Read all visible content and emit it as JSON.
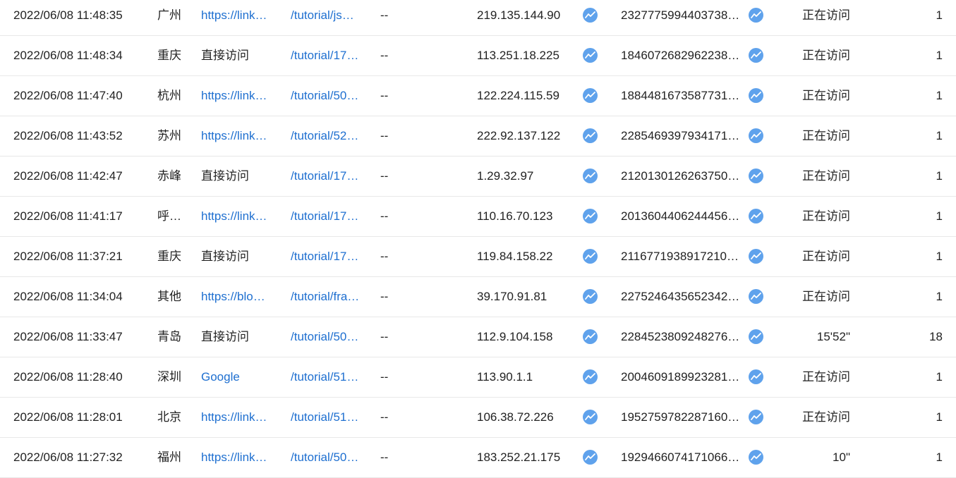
{
  "icons": {
    "trend": "trend-chart-icon",
    "trend_color": "#5fa2ec",
    "link_color": "#1e6fd0"
  },
  "rows": [
    {
      "time": "2022/06/08 11:48:35",
      "region": "广州",
      "source": "https://link…",
      "source_is_link": true,
      "page": "/tutorial/js…",
      "keyword": "--",
      "ip": "219.135.144.90",
      "visitor_id": "2327775994403738…",
      "duration": "正在访问",
      "pageviews": "1"
    },
    {
      "time": "2022/06/08 11:48:34",
      "region": "重庆",
      "source": "直接访问",
      "source_is_link": false,
      "page": "/tutorial/17…",
      "keyword": "--",
      "ip": "113.251.18.225",
      "visitor_id": "1846072682962238…",
      "duration": "正在访问",
      "pageviews": "1"
    },
    {
      "time": "2022/06/08 11:47:40",
      "region": "杭州",
      "source": "https://link…",
      "source_is_link": true,
      "page": "/tutorial/50…",
      "keyword": "--",
      "ip": "122.224.115.59",
      "visitor_id": "1884481673587731…",
      "duration": "正在访问",
      "pageviews": "1"
    },
    {
      "time": "2022/06/08 11:43:52",
      "region": "苏州",
      "source": "https://link…",
      "source_is_link": true,
      "page": "/tutorial/52…",
      "keyword": "--",
      "ip": "222.92.137.122",
      "visitor_id": "2285469397934171…",
      "duration": "正在访问",
      "pageviews": "1"
    },
    {
      "time": "2022/06/08 11:42:47",
      "region": "赤峰",
      "source": "直接访问",
      "source_is_link": false,
      "page": "/tutorial/17…",
      "keyword": "--",
      "ip": "1.29.32.97",
      "visitor_id": "2120130126263750…",
      "duration": "正在访问",
      "pageviews": "1"
    },
    {
      "time": "2022/06/08 11:41:17",
      "region": "呼…",
      "source": "https://link…",
      "source_is_link": true,
      "page": "/tutorial/17…",
      "keyword": "--",
      "ip": "110.16.70.123",
      "visitor_id": "2013604406244456…",
      "duration": "正在访问",
      "pageviews": "1"
    },
    {
      "time": "2022/06/08 11:37:21",
      "region": "重庆",
      "source": "直接访问",
      "source_is_link": false,
      "page": "/tutorial/17…",
      "keyword": "--",
      "ip": "119.84.158.22",
      "visitor_id": "2116771938917210…",
      "duration": "正在访问",
      "pageviews": "1"
    },
    {
      "time": "2022/06/08 11:34:04",
      "region": "其他",
      "source": "https://blo…",
      "source_is_link": true,
      "page": "/tutorial/fra…",
      "keyword": "--",
      "ip": "39.170.91.81",
      "visitor_id": "2275246435652342…",
      "duration": "正在访问",
      "pageviews": "1"
    },
    {
      "time": "2022/06/08 11:33:47",
      "region": "青岛",
      "source": "直接访问",
      "source_is_link": false,
      "page": "/tutorial/50…",
      "keyword": "--",
      "ip": "112.9.104.158",
      "visitor_id": "2284523809248276…",
      "duration": "15'52\"",
      "pageviews": "18"
    },
    {
      "time": "2022/06/08 11:28:40",
      "region": "深圳",
      "source": "Google",
      "source_is_link": true,
      "page": "/tutorial/51…",
      "keyword": "--",
      "ip": "113.90.1.1",
      "visitor_id": "2004609189923281…",
      "duration": "正在访问",
      "pageviews": "1"
    },
    {
      "time": "2022/06/08 11:28:01",
      "region": "北京",
      "source": "https://link…",
      "source_is_link": true,
      "page": "/tutorial/51…",
      "keyword": "--",
      "ip": "106.38.72.226",
      "visitor_id": "1952759782287160…",
      "duration": "正在访问",
      "pageviews": "1"
    },
    {
      "time": "2022/06/08 11:27:32",
      "region": "福州",
      "source": "https://link…",
      "source_is_link": true,
      "page": "/tutorial/50…",
      "keyword": "--",
      "ip": "183.252.21.175",
      "visitor_id": "1929466074171066…",
      "duration": "10\"",
      "pageviews": "1"
    }
  ]
}
